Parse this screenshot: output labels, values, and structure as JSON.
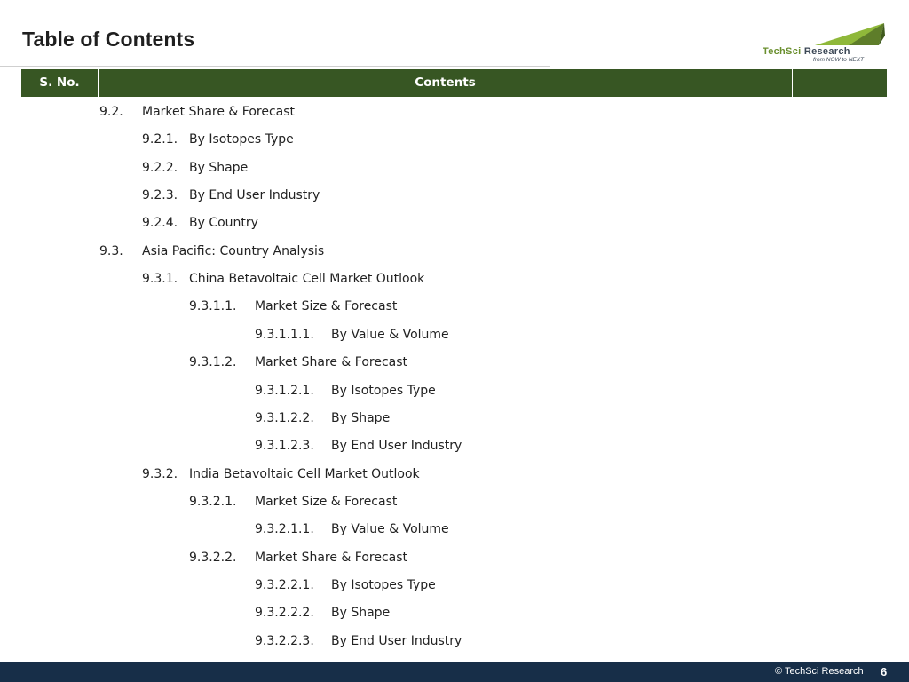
{
  "page": {
    "title": "Table of Contents",
    "page_number": "6",
    "copyright": "© TechSci Research"
  },
  "logo": {
    "name_part1": "TechSci",
    "name_part2": "Research",
    "tagline": "from NOW to NEXT",
    "colors": {
      "green": "#6a8f2e",
      "dark": "#3c4856"
    }
  },
  "table_header": {
    "sno": "S. No.",
    "contents": "Contents",
    "background_color": "#375623"
  },
  "entries": [
    {
      "num": "9.2.",
      "text": "Market Share & Forecast",
      "level": 1
    },
    {
      "num": "9.2.1.",
      "text": "By Isotopes Type",
      "level": 2
    },
    {
      "num": "9.2.2.",
      "text": "By Shape",
      "level": 2
    },
    {
      "num": "9.2.3.",
      "text": "By End User Industry",
      "level": 2
    },
    {
      "num": "9.2.4.",
      "text": "By Country",
      "level": 2
    },
    {
      "num": "9.3.",
      "text": "Asia Pacific: Country Analysis",
      "level": 1
    },
    {
      "num": "9.3.1.",
      "text": "China Betavoltaic Cell Market Outlook",
      "level": 2
    },
    {
      "num": "9.3.1.1.",
      "text": "Market Size & Forecast",
      "level": 3
    },
    {
      "num": "9.3.1.1.1.",
      "text": "By Value & Volume",
      "level": 4
    },
    {
      "num": "9.3.1.2.",
      "text": "Market Share & Forecast",
      "level": 3
    },
    {
      "num": "9.3.1.2.1.",
      "text": "By Isotopes Type",
      "level": 4
    },
    {
      "num": "9.3.1.2.2.",
      "text": "By Shape",
      "level": 4
    },
    {
      "num": "9.3.1.2.3.",
      "text": "By End User Industry",
      "level": 4
    },
    {
      "num": "9.3.2.",
      "text": "India Betavoltaic Cell Market Outlook",
      "level": 2
    },
    {
      "num": "9.3.2.1.",
      "text": "Market Size & Forecast",
      "level": 3
    },
    {
      "num": "9.3.2.1.1.",
      "text": "By Value & Volume",
      "level": 4
    },
    {
      "num": "9.3.2.2.",
      "text": "Market Share & Forecast",
      "level": 3
    },
    {
      "num": "9.3.2.2.1.",
      "text": "By Isotopes Type",
      "level": 4
    },
    {
      "num": "9.3.2.2.2.",
      "text": "By Shape",
      "level": 4
    },
    {
      "num": "9.3.2.2.3.",
      "text": "By End User Industry",
      "level": 4
    }
  ],
  "footer": {
    "background_color": "#172e48"
  }
}
